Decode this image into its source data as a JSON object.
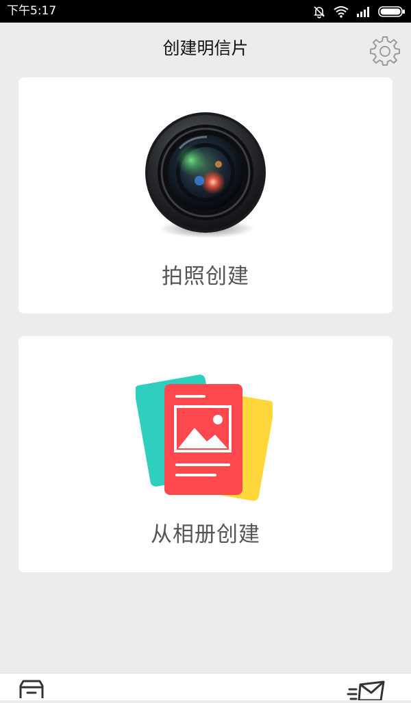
{
  "status_bar": {
    "time": "下午5:17",
    "icons": [
      "mute-icon",
      "wifi-icon",
      "signal-icon",
      "battery-icon"
    ]
  },
  "header": {
    "title": "创建明信片",
    "settings_icon": "gear-icon"
  },
  "cards": [
    {
      "label": "拍照创建",
      "icon": "camera-lens-icon"
    },
    {
      "label": "从相册创建",
      "icon": "photo-album-icon"
    }
  ],
  "bottom_bar": {
    "left_icon": "inbox-icon",
    "right_icon": "send-mail-icon"
  },
  "colors": {
    "background": "#ececec",
    "card": "#ffffff",
    "status_bar": "#000000",
    "title_text": "#111111",
    "label_text": "#555555",
    "album_teal": "#2fcfbf",
    "album_yellow": "#ffd73a",
    "album_red": "#ff3d5a"
  }
}
